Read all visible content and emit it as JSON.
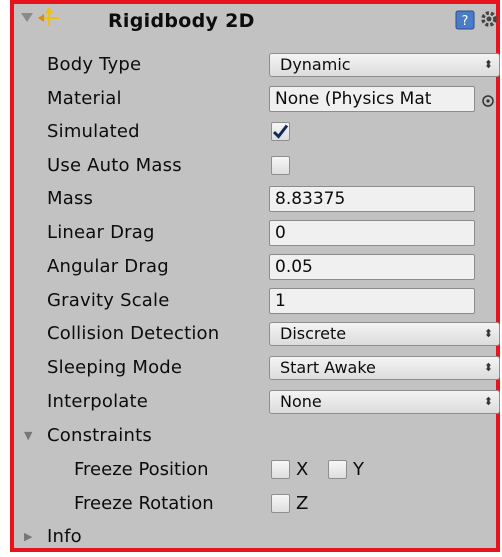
{
  "component": {
    "title": "Rigidbody 2D",
    "icon_names": [
      "collapse-triangle-icon",
      "rigidbody2d-component-icon",
      "help-book-icon",
      "gear-icon"
    ]
  },
  "fields": {
    "body_type": {
      "label": "Body Type",
      "value": "Dynamic"
    },
    "material": {
      "label": "Material",
      "value": "None (Physics Mat"
    },
    "simulated": {
      "label": "Simulated",
      "checked": true
    },
    "use_auto_mass": {
      "label": "Use Auto Mass",
      "checked": false
    },
    "mass": {
      "label": "Mass",
      "value": "8.83375"
    },
    "linear_drag": {
      "label": "Linear Drag",
      "value": "0"
    },
    "angular_drag": {
      "label": "Angular Drag",
      "value": "0.05"
    },
    "gravity_scale": {
      "label": "Gravity Scale",
      "value": "1"
    },
    "collision_detection": {
      "label": "Collision Detection",
      "value": "Discrete"
    },
    "sleeping_mode": {
      "label": "Sleeping Mode",
      "value": "Start Awake"
    },
    "interpolate": {
      "label": "Interpolate",
      "value": "None"
    }
  },
  "constraints": {
    "label": "Constraints",
    "expanded": true,
    "freeze_position": {
      "label": "Freeze Position",
      "x_label": "X",
      "y_label": "Y",
      "x": false,
      "y": false
    },
    "freeze_rotation": {
      "label": "Freeze Rotation",
      "z_label": "Z",
      "z": false
    }
  },
  "info": {
    "label": "Info",
    "expanded": false
  },
  "colors": {
    "frame": "#e8141b",
    "panel": "#c2c2c2"
  }
}
